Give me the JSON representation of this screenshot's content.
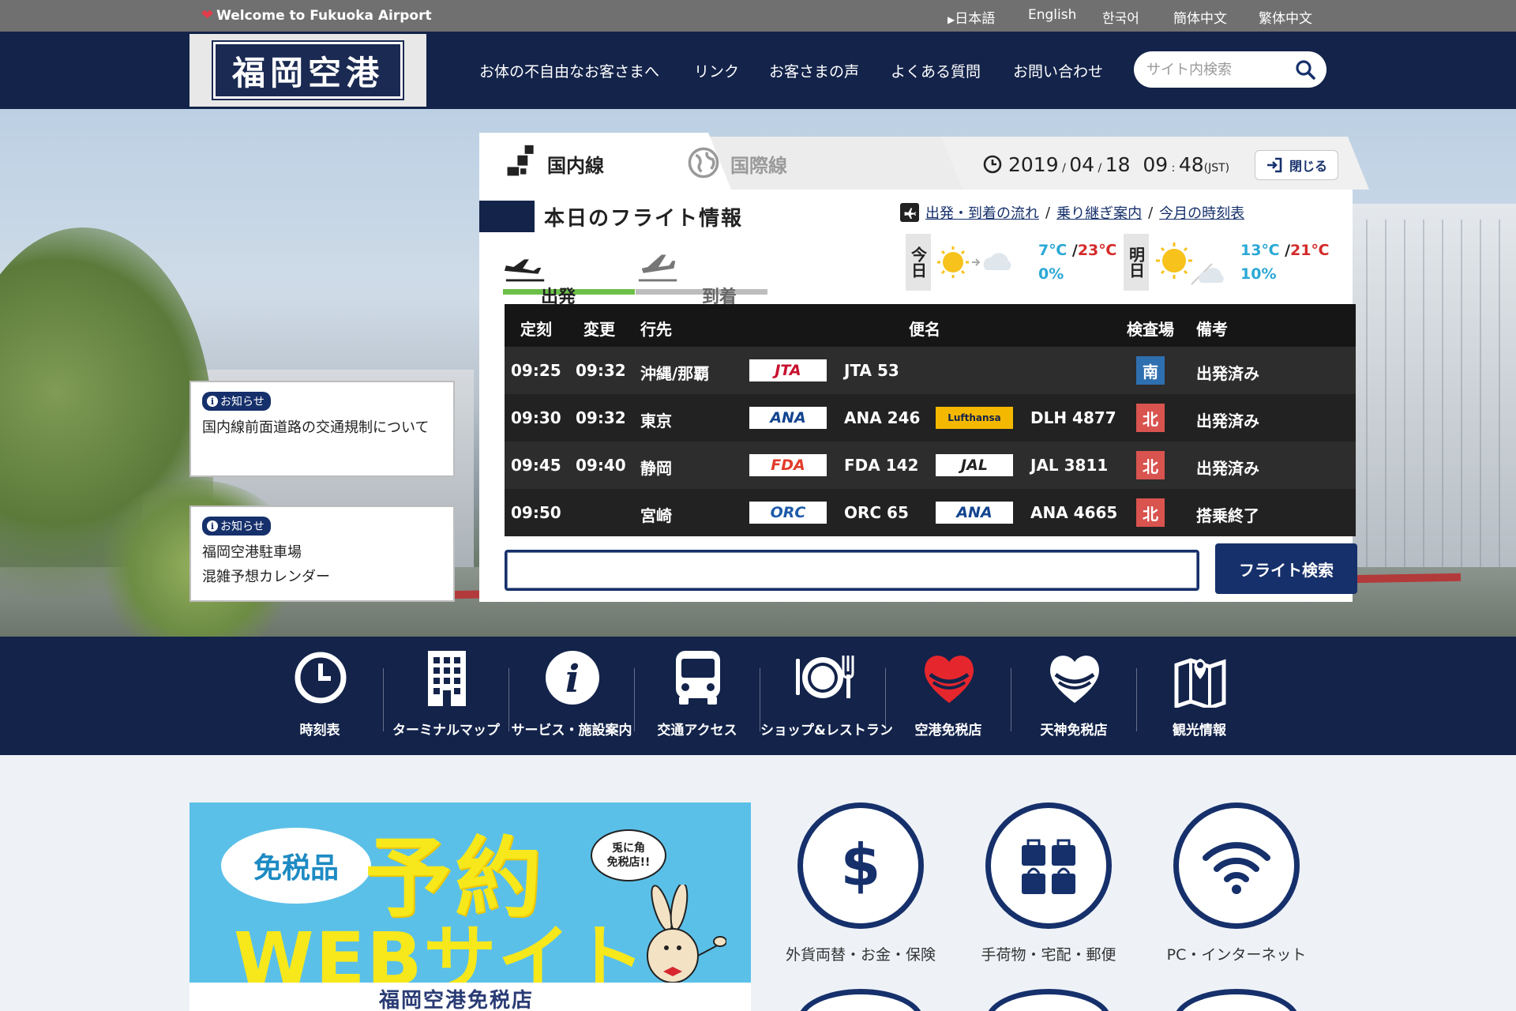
{
  "topbar": {
    "welcome": "Welcome to Fukuoka Airport",
    "languages": [
      "日本語",
      "English",
      "한국어",
      "簡体中文",
      "繁体中文"
    ]
  },
  "header": {
    "logo": "福岡空港",
    "nav": [
      "お体の不自由なお客さまへ",
      "リンク",
      "お客さまの声",
      "よくある質問",
      "お問い合わせ"
    ],
    "search_placeholder": "サイト内検索"
  },
  "notices": [
    {
      "badge": "お知らせ",
      "text": "国内線前面道路の交通規制について"
    },
    {
      "badge": "お知らせ",
      "text": "福岡空港駐車場\n混雑予想カレンダー"
    }
  ],
  "flight_panel": {
    "tab_domestic": "国内線",
    "tab_international": "国際線",
    "date": "2019",
    "month": "04",
    "day": "18",
    "time_h": "09",
    "time_m": "48",
    "tz": "(JST)",
    "close_label": "閉じる",
    "section_title": "本日のフライト情報",
    "links": [
      "出発・到着の流れ",
      "乗り継ぎ案内",
      "今月の時刻表"
    ],
    "tab_departure": "出発",
    "tab_arrival": "到着",
    "weather": [
      {
        "day": "今日",
        "low": "7℃",
        "high": "23℃",
        "sep": "/",
        "rain": "0%"
      },
      {
        "day": "明日",
        "low": "13℃",
        "high": "21℃",
        "sep": "/",
        "rain": "10%"
      }
    ],
    "columns": [
      "定刻",
      "変更",
      "行先",
      "便名",
      "検査場",
      "備考"
    ],
    "rows": [
      {
        "sched": "09:25",
        "changed": "09:32",
        "dest": "沖縄/那覇",
        "logo1": "JTA",
        "flight1": "JTA 53",
        "logo2": "",
        "flight2": "",
        "gate": "南",
        "gate_color": "#2e6fb0",
        "remark": "出発済み"
      },
      {
        "sched": "09:30",
        "changed": "09:32",
        "dest": "東京",
        "logo1": "ANA",
        "flight1": "ANA 246",
        "logo2": "Lufthansa",
        "flight2": "DLH 4877",
        "gate": "北",
        "gate_color": "#d9534f",
        "remark": "出発済み"
      },
      {
        "sched": "09:45",
        "changed": "09:40",
        "dest": "静岡",
        "logo1": "FDA",
        "flight1": "FDA 142",
        "logo2": "JAL",
        "flight2": "JAL 3811",
        "gate": "北",
        "gate_color": "#d9534f",
        "remark": "出発済み"
      },
      {
        "sched": "09:50",
        "changed": "",
        "dest": "宮崎",
        "logo1": "ORC",
        "flight1": "ORC 65",
        "logo2": "ANA",
        "flight2": "ANA 4665",
        "gate": "北",
        "gate_color": "#d9534f",
        "remark": "搭乗終了"
      }
    ],
    "search_value": "",
    "search_button": "フライト検索"
  },
  "icon_nav": [
    {
      "label": "時刻表",
      "icon": "clock-icon"
    },
    {
      "label": "ターミナルマップ",
      "icon": "building-icon"
    },
    {
      "label": "サービス・施設案内",
      "icon": "info-icon"
    },
    {
      "label": "交通アクセス",
      "icon": "bus-icon"
    },
    {
      "label": "ショップ&レストラン",
      "icon": "dining-icon"
    },
    {
      "label": "空港免税店",
      "icon": "heart-red-icon"
    },
    {
      "label": "天神免税店",
      "icon": "heart-white-icon"
    },
    {
      "label": "観光情報",
      "icon": "map-icon"
    }
  ],
  "banner": {
    "bubble": "免税品",
    "headline": "予約",
    "sub": "WEBサイト",
    "speech": "兎に角\n免税店!!",
    "store": "福岡空港免税店"
  },
  "services": [
    {
      "label": "外貨両替・お金・保険",
      "icon": "dollar-icon"
    },
    {
      "label": "手荷物・宅配・郵便",
      "icon": "luggage-icon"
    },
    {
      "label": "PC・インターネット",
      "icon": "wifi-icon"
    }
  ],
  "colors": {
    "navy": "#13234a",
    "accent_green": "#6cc04a",
    "gate_south": "#2e6fb0",
    "gate_north": "#d9534f"
  }
}
